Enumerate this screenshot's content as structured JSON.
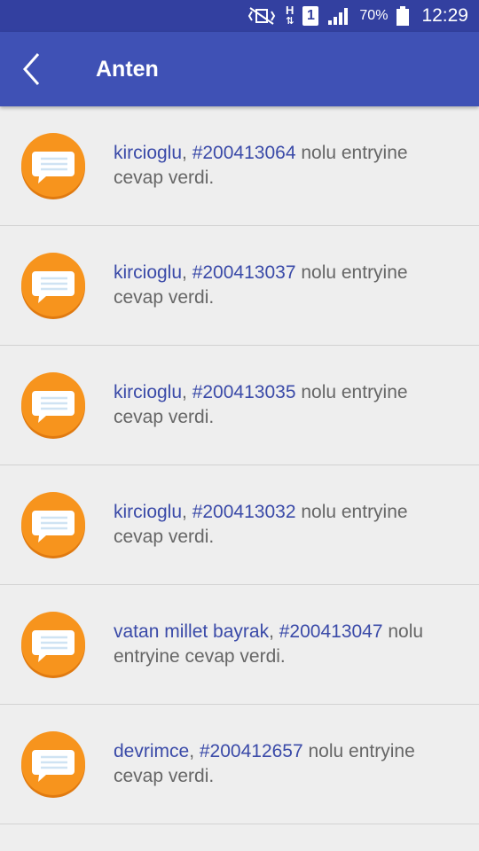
{
  "status_bar": {
    "network_label": "H",
    "sim_label": "1",
    "battery_percent": "70%",
    "time": "12:29"
  },
  "app_bar": {
    "title": "Anten"
  },
  "notifications": [
    {
      "user": "kircioglu",
      "sep": ", ",
      "entry": "#200413064",
      "text": " nolu entryine cevap verdi."
    },
    {
      "user": "kircioglu",
      "sep": ", ",
      "entry": "#200413037",
      "text": " nolu entryine cevap verdi."
    },
    {
      "user": "kircioglu",
      "sep": ", ",
      "entry": "#200413035",
      "text": " nolu entryine cevap verdi."
    },
    {
      "user": "kircioglu",
      "sep": ", ",
      "entry": "#200413032",
      "text": " nolu entryine cevap verdi."
    },
    {
      "user": "vatan millet bayrak",
      "sep": ", ",
      "entry": "#200413047",
      "text": " nolu entryine cevap verdi."
    },
    {
      "user": "devrimce",
      "sep": ", ",
      "entry": "#200412657",
      "text": " nolu entryine cevap verdi."
    }
  ],
  "colors": {
    "primary": "#3f51b5",
    "status_bar": "#3340a0",
    "link": "#3a4aa8",
    "icon_orange": "#f7941d"
  }
}
